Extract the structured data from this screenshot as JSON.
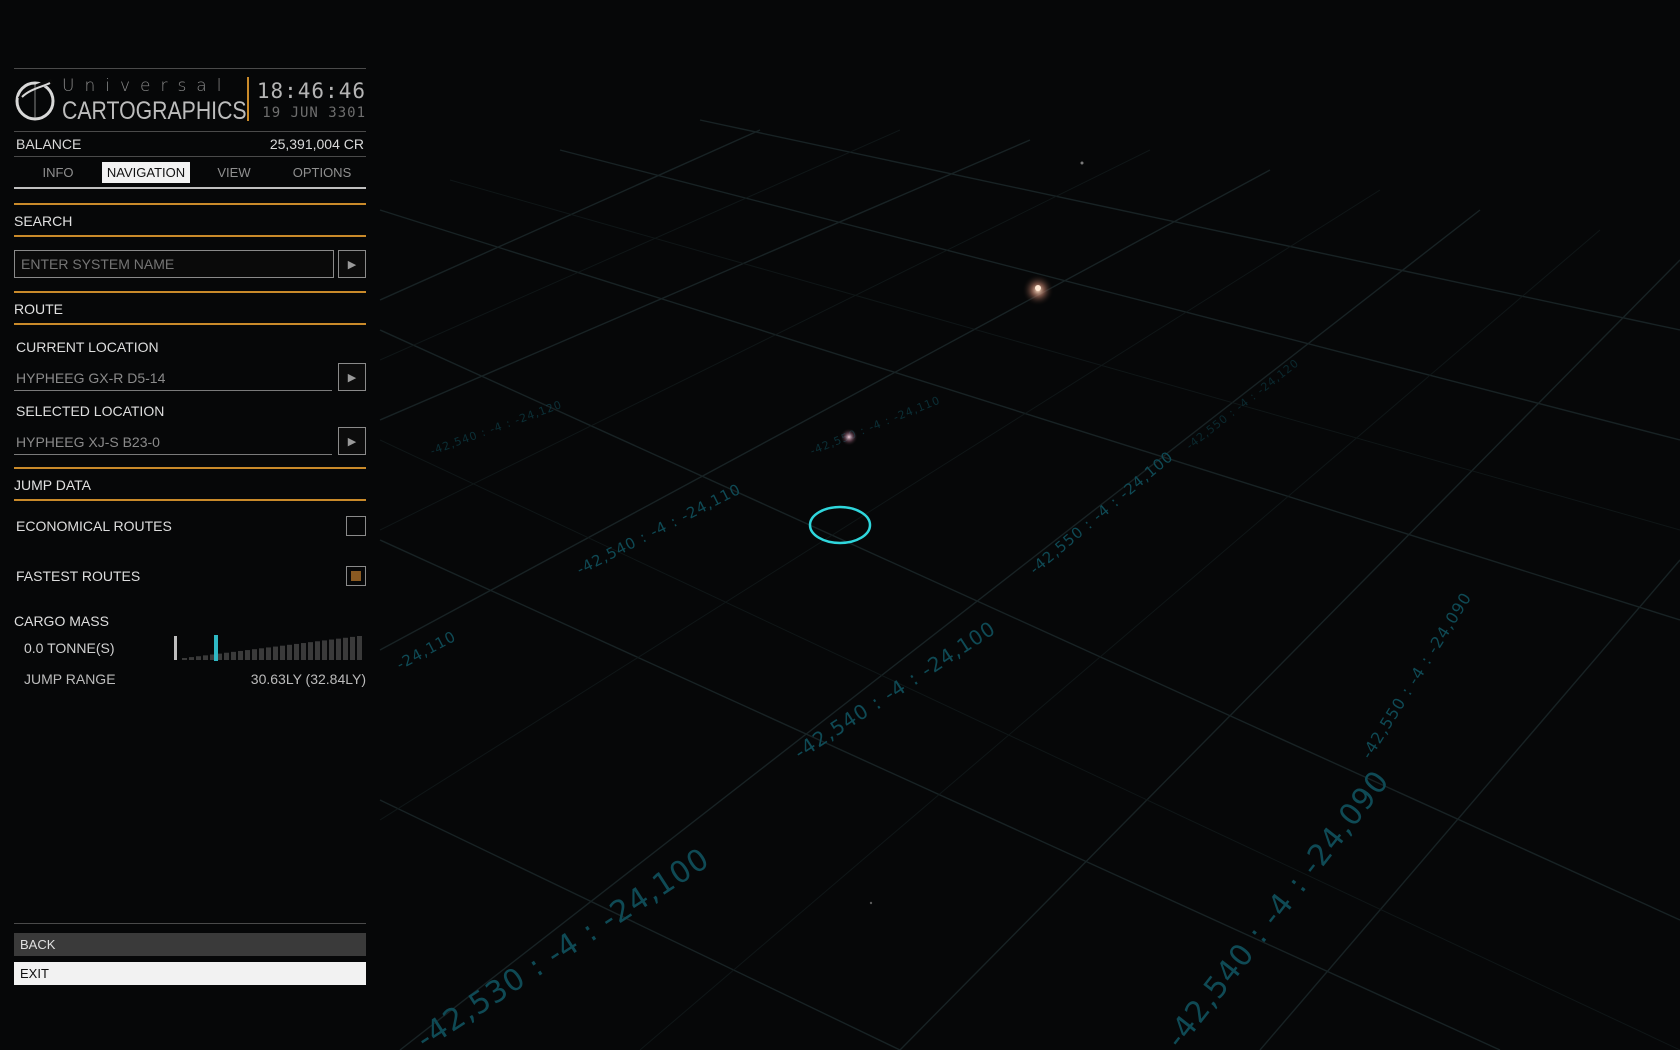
{
  "header": {
    "logo_top": "Universal",
    "logo_bottom": "CARTOGRAPHICS",
    "time": "18:46:46",
    "date": "19 JUN 3301"
  },
  "balance": {
    "label": "BALANCE",
    "value": "25,391,004 CR"
  },
  "tabs": [
    {
      "label": "INFO",
      "active": false
    },
    {
      "label": "NAVIGATION",
      "active": true
    },
    {
      "label": "VIEW",
      "active": false
    },
    {
      "label": "OPTIONS",
      "active": false
    }
  ],
  "search": {
    "title": "SEARCH",
    "placeholder": "ENTER SYSTEM NAME"
  },
  "route": {
    "title": "ROUTE",
    "current_label": "CURRENT LOCATION",
    "current_value": "HYPHEEG GX-R D5-14",
    "selected_label": "SELECTED LOCATION",
    "selected_value": "HYPHEEG XJ-S B23-0"
  },
  "jump_data": {
    "title": "JUMP DATA",
    "economical_label": "ECONOMICAL ROUTES",
    "economical_checked": false,
    "fastest_label": "FASTEST ROUTES",
    "fastest_checked": true,
    "cargo_title": "CARGO MASS",
    "cargo_value": "0.0 TONNE(S)",
    "cargo_fraction": 0.0,
    "range_label": "JUMP RANGE",
    "range_value": "30.63LY (32.84LY)"
  },
  "menu": {
    "back": "BACK",
    "exit": "EXIT"
  },
  "map": {
    "grid_labels": [
      "-42,540 : -4 : -24,100",
      "-42,540 : -4 : -24,110",
      "-42,550 : -4 : -24,100",
      "-42,550 : -4 : -24,090",
      "-42,530 : -4 : -24,100",
      "-42,540 : -4 : -24,090",
      "-24,110",
      "-42,540 : -4 : -24,120",
      "-42,550 : -4 : -24,110",
      "-42,550 : -4 : -24,120"
    ]
  },
  "colors": {
    "accent": "#c98a2a",
    "selector": "#2fd6dc",
    "grid": "#0f4a55"
  }
}
